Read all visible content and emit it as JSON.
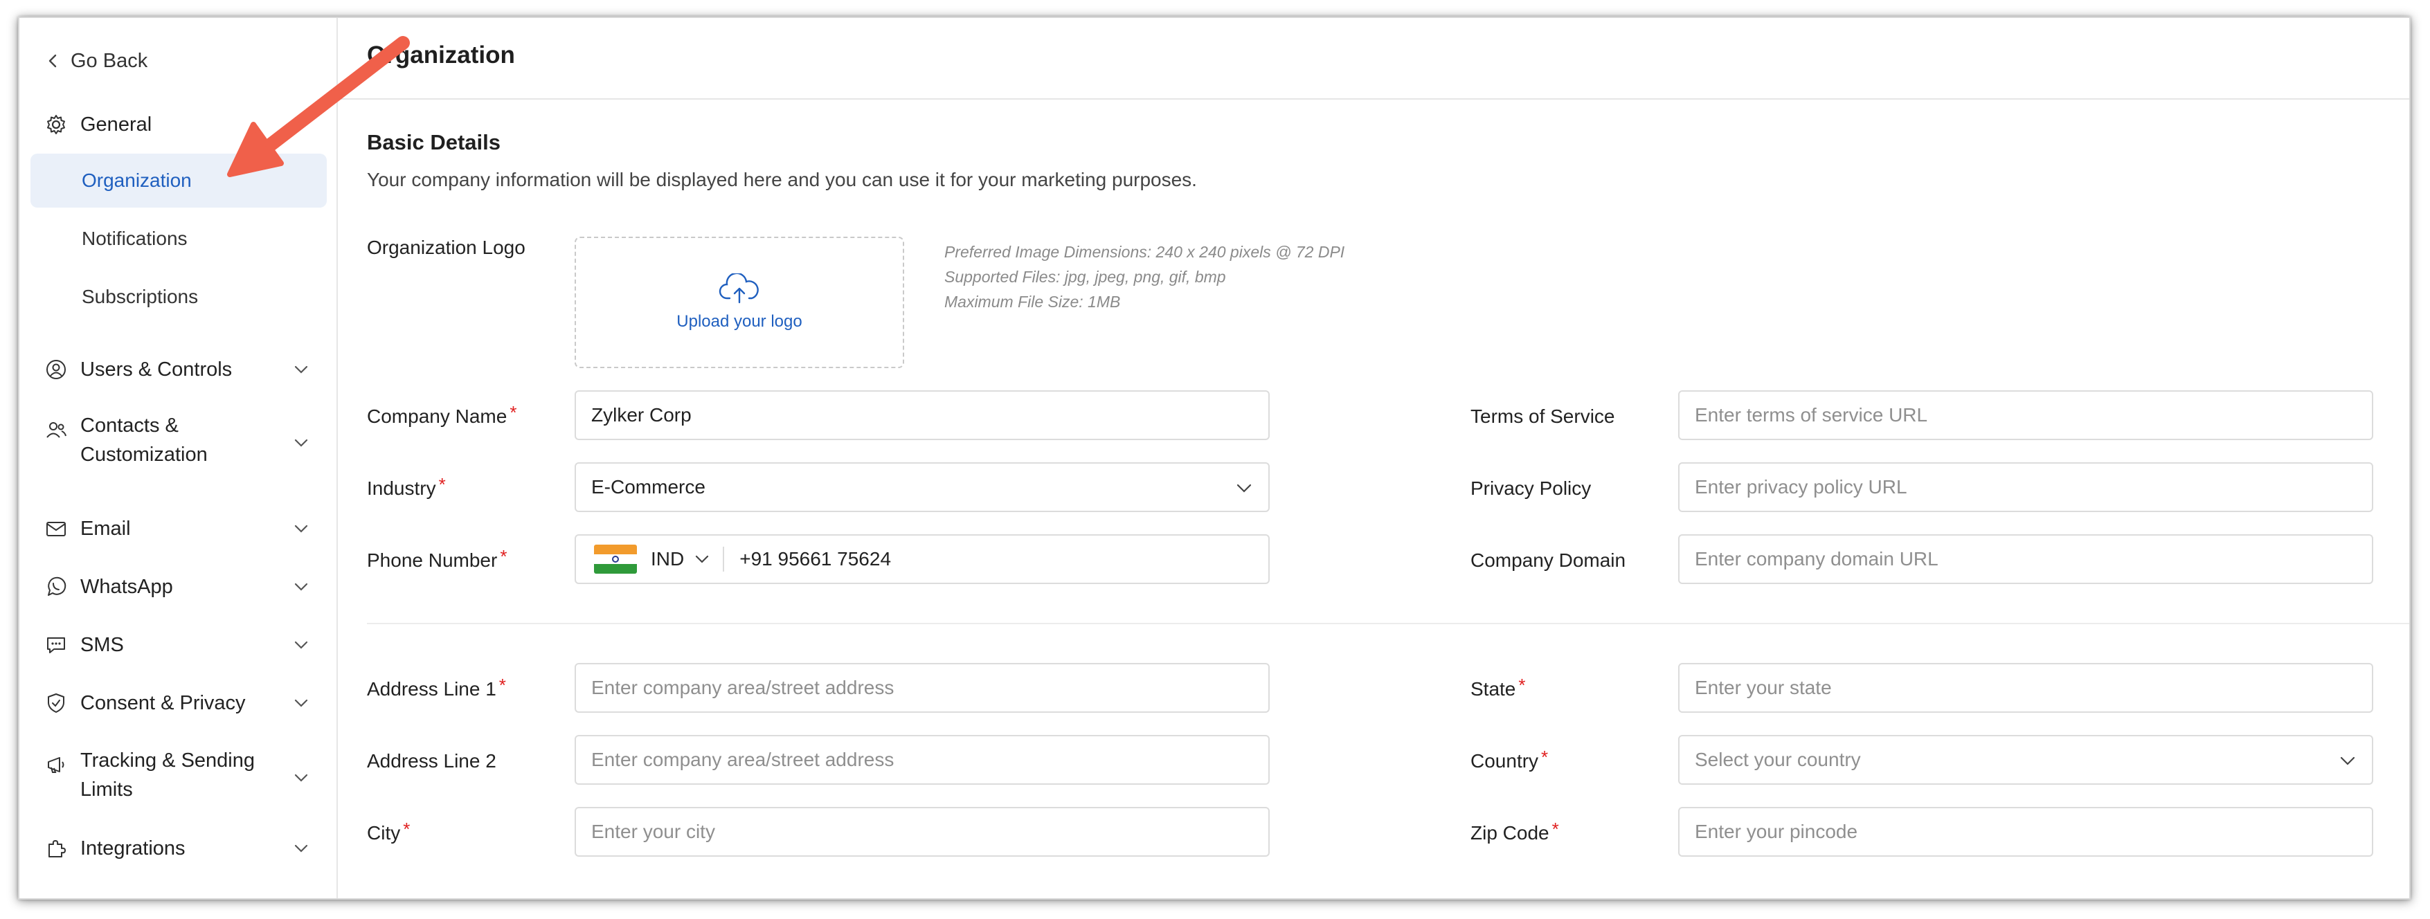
{
  "sidebar": {
    "go_back": "Go Back",
    "general": "General",
    "sub_items": [
      "Organization",
      "Notifications",
      "Subscriptions"
    ],
    "active_sub_item": "Organization",
    "groups": [
      "Users & Controls",
      "Contacts &",
      "Customization",
      "Email",
      "WhatsApp",
      "SMS",
      "Consent & Privacy",
      "Tracking & Sending",
      "Limits",
      "Integrations"
    ]
  },
  "main": {
    "title": "Organization",
    "section_title": "Basic Details",
    "section_desc": "Your company information will be displayed here and you can use it for your marketing purposes.",
    "logo": {
      "label": "Organization Logo",
      "upload_text": "Upload your logo",
      "info": [
        "Preferred Image Dimensions: 240 x 240 pixels @ 72 DPI",
        "Supported Files: jpg, jpeg, png, gif, bmp",
        "Maximum File Size: 1MB"
      ]
    },
    "left_fields": {
      "company_name": {
        "label": "Company Name",
        "value": "Zylker Corp"
      },
      "industry": {
        "label": "Industry",
        "value": "E-Commerce"
      },
      "phone": {
        "label": "Phone Number",
        "country": "IND",
        "value": "+91 95661 75624"
      },
      "address1": {
        "label": "Address Line 1",
        "placeholder": "Enter company area/street address"
      },
      "address2": {
        "label": "Address Line 2",
        "placeholder": "Enter company area/street address"
      },
      "city": {
        "label": "City",
        "placeholder": "Enter your city"
      }
    },
    "right_fields": {
      "terms": {
        "label": "Terms of Service",
        "placeholder": "Enter terms of service URL"
      },
      "privacy": {
        "label": "Privacy Policy",
        "placeholder": "Enter privacy policy URL"
      },
      "domain": {
        "label": "Company Domain",
        "placeholder": "Enter company domain URL"
      },
      "state": {
        "label": "State",
        "placeholder": "Enter your state"
      },
      "country": {
        "label": "Country",
        "placeholder": "Select your country"
      },
      "zip": {
        "label": "Zip Code",
        "placeholder": "Enter your pincode"
      }
    },
    "required_mark": "*"
  },
  "colors": {
    "accent": "#1f5fbf",
    "active_bg": "#eaf0f9",
    "required": "#e02020",
    "annotation_arrow": "#f0604a"
  }
}
